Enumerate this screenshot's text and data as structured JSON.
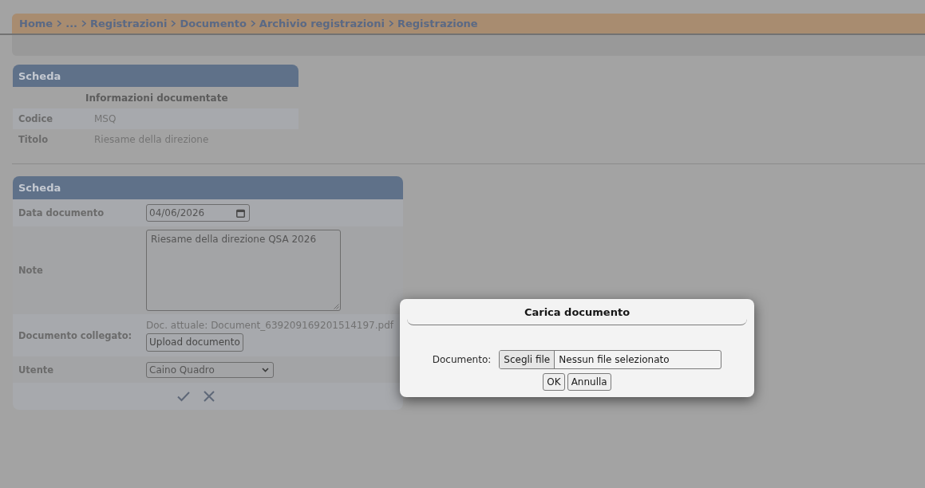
{
  "breadcrumb": [
    {
      "label": "Home"
    },
    {
      "label": "..."
    },
    {
      "label": "Registrazioni"
    },
    {
      "label": "Documento"
    },
    {
      "label": "Archivio registrazioni"
    },
    {
      "label": "Registrazione"
    }
  ],
  "info_panel": {
    "title": "Scheda",
    "heading": "Informazioni documentate",
    "rows": [
      {
        "label": "Codice",
        "value": "MSQ"
      },
      {
        "label": "Titolo",
        "value": "Riesame della direzione"
      }
    ]
  },
  "form_panel": {
    "title": "Scheda",
    "fields": [
      {
        "kind": "date",
        "label": "Data documento",
        "value": "04/06/2026"
      },
      {
        "kind": "textarea",
        "label": "Note",
        "value": "Riesame della direzione QSA 2026"
      },
      {
        "kind": "upload",
        "label": "Documento collegato:",
        "current_label": "Doc. attuale:",
        "current_file": "Document_639209169201514197.pdf",
        "button": "Upload documento"
      },
      {
        "kind": "select",
        "label": "Utente",
        "value": "Caino Quadro"
      }
    ]
  },
  "modal": {
    "title": "Carica documento",
    "field_label": "Documento:",
    "file_button": "Scegli file",
    "file_status": "Nessun file selezionato",
    "buttons": [
      "OK",
      "Annulla"
    ]
  }
}
